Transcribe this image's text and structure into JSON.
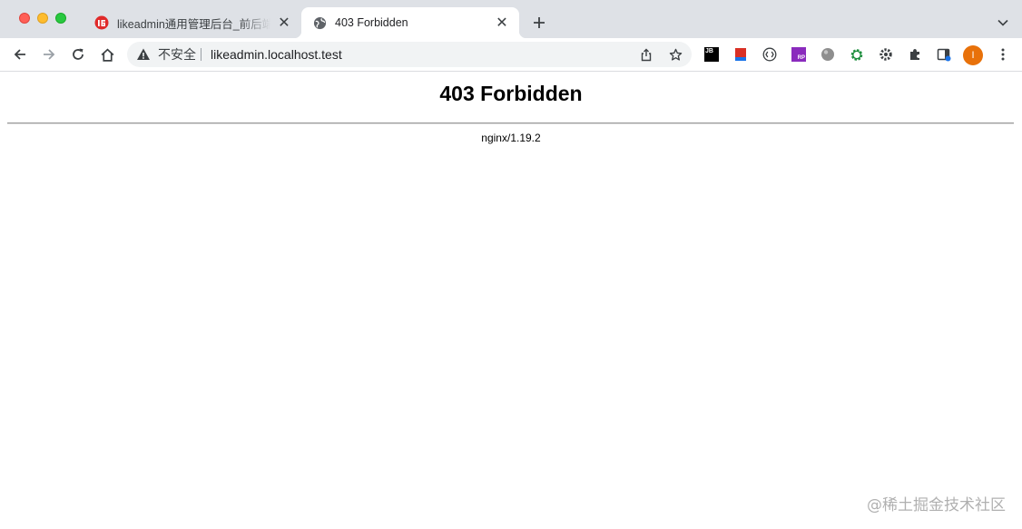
{
  "tabs": [
    {
      "title": "likeadmin通用管理后台_前后端分离",
      "active": false,
      "favicon": "likeadmin-logo-icon"
    },
    {
      "title": "403 Forbidden",
      "active": true,
      "favicon": "globe-icon"
    }
  ],
  "omnibox": {
    "security_label": "不安全",
    "url": "likeadmin.localhost.test"
  },
  "profile": {
    "initial": "I",
    "color": "#e8710a"
  },
  "extensions": {
    "jetbrains_label": "JB",
    "rp_label": "RP"
  },
  "page": {
    "title": "403 Forbidden",
    "server": "nginx/1.19.2"
  },
  "watermark": "@稀土掘金技术社区"
}
